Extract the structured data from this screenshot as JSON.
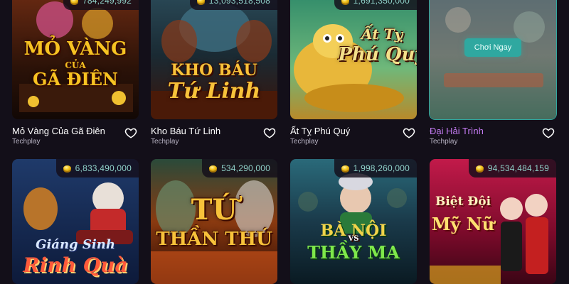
{
  "games": [
    {
      "title": "Mỏ Vàng Của Gã Điên",
      "provider": "Techplay",
      "jackpot": "784,249,992",
      "art_lines": [
        "MỎ VÀNG",
        "CỦA",
        "GÃ ĐIÊN"
      ]
    },
    {
      "title": "Kho Báu Tứ Linh",
      "provider": "Techplay",
      "jackpot": "13,093,518,508",
      "art_lines": [
        "KHO BÁU",
        "Tứ Linh"
      ]
    },
    {
      "title": "Ất Tỵ Phú Quý",
      "provider": "Techplay",
      "jackpot": "1,691,350,000",
      "art_lines": [
        "Ất Tỵ",
        "Phú Quý"
      ]
    },
    {
      "title": "Đại Hải Trình",
      "provider": "Techplay",
      "jackpot": "",
      "play_label": "Chơi Ngay",
      "art_lines": []
    },
    {
      "title": "",
      "provider": "",
      "jackpot": "6,833,490,000",
      "art_lines": [
        "Giáng Sinh",
        "Rinh Quà"
      ]
    },
    {
      "title": "",
      "provider": "",
      "jackpot": "534,290,000",
      "art_lines": [
        "TỨ",
        "THẦN THÚ"
      ]
    },
    {
      "title": "",
      "provider": "",
      "jackpot": "1,998,260,000",
      "art_lines": [
        "BÀ NỘI",
        "VS",
        "THẦY MA"
      ]
    },
    {
      "title": "",
      "provider": "",
      "jackpot": "94,534,484,159",
      "art_lines": [
        "Biệt Đội",
        "Mỹ Nữ"
      ]
    }
  ],
  "colors": {
    "background": "#130f19",
    "highlight_title": "#c47bf2",
    "play_button": "#2fa8a0",
    "jackpot_text": "#8fd0c8"
  }
}
